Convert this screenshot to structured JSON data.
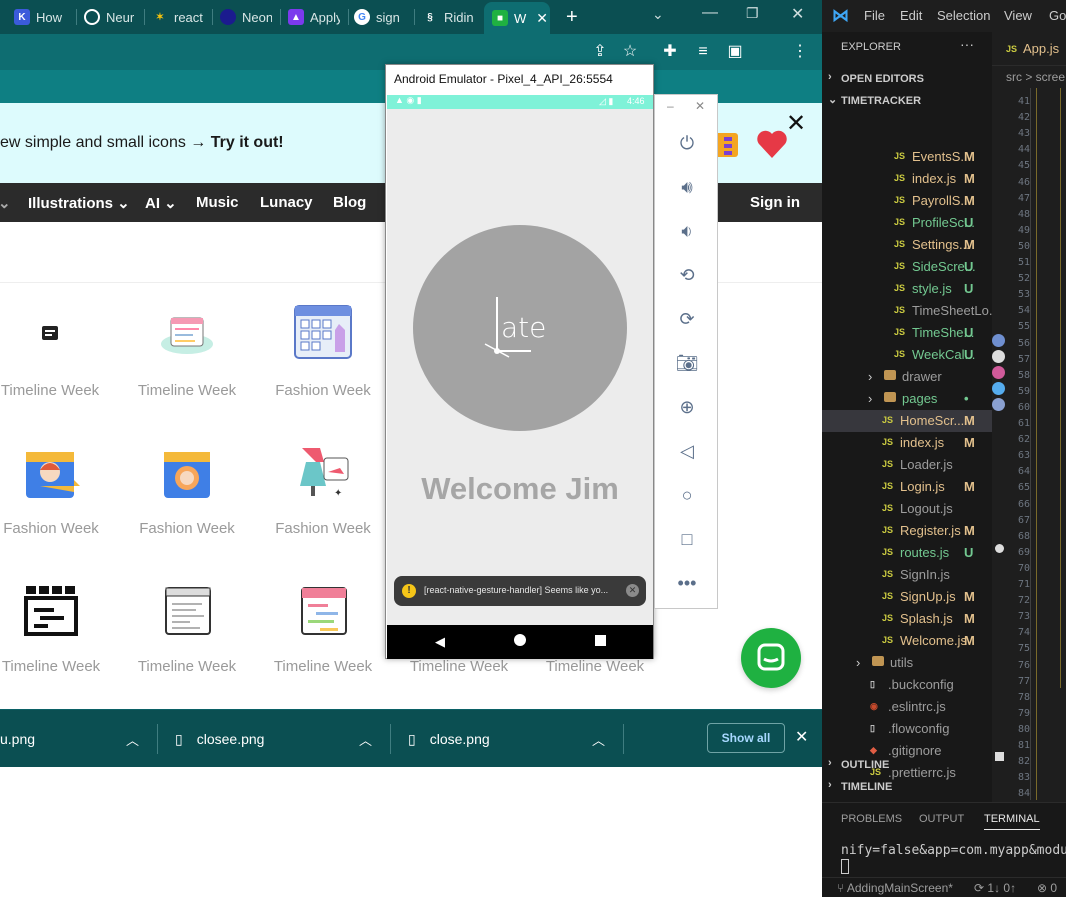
{
  "browser": {
    "tabs": [
      {
        "label": "How",
        "icon": "k-logo-icon",
        "color": "#3b5bdb"
      },
      {
        "label": "Neur",
        "icon": "chatgpt-icon",
        "color": "#0b4f52"
      },
      {
        "label": "react",
        "icon": "sparkle-icon",
        "color": "#0b4f52"
      },
      {
        "label": "Neon",
        "icon": "circle-logo-icon",
        "color": "#1b1b6e"
      },
      {
        "label": "Apply",
        "icon": "rocket-icon",
        "color": "#7c3aed"
      },
      {
        "label": "sign",
        "icon": "google-icon",
        "color": "#ffffff"
      },
      {
        "label": "Ridin",
        "icon": "stripes-logo-icon",
        "color": "#0b4f52"
      },
      {
        "label": "W",
        "icon": "icons8-icon",
        "color": "#1fb141"
      }
    ],
    "new_tab": "+"
  },
  "page": {
    "promo_text": "ew simple and small icons →",
    "promo_cta": "Try it out!",
    "nav": [
      "Illustrations",
      "AI",
      "Music",
      "Lunacy",
      "Blog"
    ],
    "sign_in": "Sign in",
    "grid": [
      [
        "Timeline Week",
        "Timeline Week",
        "Fashion Week"
      ],
      [
        "Fashion Week",
        "Fashion Week",
        "Fashion Week"
      ],
      [
        "Timeline Week",
        "Timeline Week",
        "Timeline Week",
        "Timeline Week",
        "Timeline Week"
      ]
    ]
  },
  "downloads": {
    "items": [
      "u.png",
      "closee.png",
      "close.png"
    ],
    "show_all": "Show all"
  },
  "emulator": {
    "title": "Android Emulator - Pixel_4_API_26:5554",
    "clock": "4:46",
    "logo_text": "ate",
    "welcome": "Welcome Jim",
    "toast": "[react-native-gesture-handler] Seems like yo..."
  },
  "vscode": {
    "menu": [
      "File",
      "Edit",
      "Selection",
      "View",
      "Go"
    ],
    "explorer_title": "EXPLORER",
    "open_tab": "App.js",
    "breadcrumb": "src > scree",
    "sections": {
      "open_editors": "OPEN EDITORS",
      "project": "TIMETRACKER",
      "outline": "OUTLINE",
      "timeline": "TIMELINE"
    },
    "files": [
      {
        "name": "EventsS...",
        "status": "M",
        "kind": "js",
        "indent": 2
      },
      {
        "name": "index.js",
        "status": "M",
        "kind": "js",
        "indent": 2
      },
      {
        "name": "PayrollS...",
        "status": "M",
        "kind": "js",
        "indent": 2
      },
      {
        "name": "ProfileSc...",
        "status": "U",
        "kind": "js",
        "indent": 2
      },
      {
        "name": "Settings...",
        "status": "M",
        "kind": "js",
        "indent": 2
      },
      {
        "name": "SideScre...",
        "status": "U",
        "kind": "js",
        "indent": 2
      },
      {
        "name": "style.js",
        "status": "U",
        "kind": "js",
        "indent": 2
      },
      {
        "name": "TimeSheetLo...",
        "status": "",
        "kind": "js",
        "indent": 2
      },
      {
        "name": "TimeShe...",
        "status": "U",
        "kind": "js",
        "indent": 2
      },
      {
        "name": "WeekCal...",
        "status": "U",
        "kind": "js",
        "indent": 2
      },
      {
        "name": "drawer",
        "status": "",
        "kind": "folder",
        "indent": 1
      },
      {
        "name": "pages",
        "status": "•",
        "kind": "folder",
        "indent": 1
      },
      {
        "name": "HomeScr...",
        "status": "M",
        "kind": "js",
        "indent": 1
      },
      {
        "name": "index.js",
        "status": "M",
        "kind": "js",
        "indent": 1
      },
      {
        "name": "Loader.js",
        "status": "",
        "kind": "js",
        "indent": 1
      },
      {
        "name": "Login.js",
        "status": "M",
        "kind": "js",
        "indent": 1
      },
      {
        "name": "Logout.js",
        "status": "",
        "kind": "js",
        "indent": 1
      },
      {
        "name": "Register.js",
        "status": "M",
        "kind": "js",
        "indent": 1
      },
      {
        "name": "routes.js",
        "status": "U",
        "kind": "js",
        "indent": 1
      },
      {
        "name": "SignIn.js",
        "status": "",
        "kind": "js",
        "indent": 1
      },
      {
        "name": "SignUp.js",
        "status": "M",
        "kind": "js",
        "indent": 1
      },
      {
        "name": "Splash.js",
        "status": "M",
        "kind": "js",
        "indent": 1
      },
      {
        "name": "Welcome.js",
        "status": "M",
        "kind": "js",
        "indent": 1
      },
      {
        "name": "utils",
        "status": "",
        "kind": "folder",
        "indent": 0
      },
      {
        "name": ".buckconfig",
        "status": "",
        "kind": "file",
        "indent": 0
      },
      {
        "name": ".eslintrc.js",
        "status": "",
        "kind": "eslint",
        "indent": 0
      },
      {
        "name": ".flowconfig",
        "status": "",
        "kind": "file",
        "indent": 0
      },
      {
        "name": ".gitignore",
        "status": "",
        "kind": "git",
        "indent": 0
      },
      {
        "name": ".prettierrc.js",
        "status": "",
        "kind": "js",
        "indent": 0
      }
    ],
    "line_numbers": [
      "41",
      "42",
      "43",
      "44",
      "45",
      "46",
      "47",
      "48",
      "49",
      "50",
      "51",
      "52",
      "53",
      "54",
      "55",
      "56",
      "57",
      "58",
      "59",
      "60",
      "61",
      "62",
      "63",
      "64",
      "65",
      "66",
      "67",
      "68",
      "69",
      "70",
      "71",
      "72",
      "73",
      "74",
      "75",
      "76",
      "77",
      "78",
      "79",
      "80",
      "81",
      "82",
      "83",
      "84"
    ],
    "panel_tabs": [
      "PROBLEMS",
      "OUTPUT",
      "TERMINAL"
    ],
    "terminal_line": "nify=false&app=com.myapp&modules",
    "branch": "AddingMainScreen*",
    "sync": "1↓ 0↑",
    "errors": "0"
  },
  "colors": {
    "chrome_dark": "#0b4f52",
    "chrome_toolbar": "#0e6d71",
    "accent_green": "#1fb141",
    "status_M": "#e2c08d",
    "status_U": "#73c991"
  }
}
